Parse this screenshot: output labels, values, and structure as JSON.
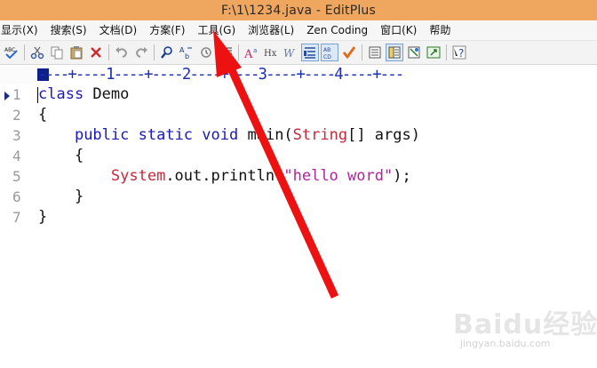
{
  "window": {
    "title": "F:\\1\\1234.java - EditPlus"
  },
  "menu": {
    "items": [
      "显示(X)",
      "搜索(S)",
      "文档(D)",
      "方案(F)",
      "工具(G)",
      "浏览器(L)",
      "Zen Coding",
      "窗口(K)",
      "帮助"
    ]
  },
  "toolbar": {
    "buttons": [
      "spell-check-icon",
      "cut-icon",
      "copy-icon",
      "paste-icon",
      "delete-icon",
      "undo-icon",
      "redo-icon",
      "find-icon",
      "replace-icon",
      "goto-icon",
      "indent-icon",
      "font-size-icon",
      "hex-icon",
      "word-wrap-icon",
      "line-number-icon",
      "column-select-icon",
      "check-icon",
      "view1-icon",
      "view2-icon",
      "view3-icon",
      "browser-icon",
      "help-icon"
    ],
    "colors": {
      "accent_active": "#7aa0cf",
      "delete": "#d02a2a",
      "check": "#e06a18"
    }
  },
  "ruler": {
    "text": "----+----1----+----2----+----3----+----4----+---"
  },
  "editor": {
    "line_numbers": [
      "1",
      "2",
      "3",
      "4",
      "5",
      "6",
      "7"
    ],
    "lines": [
      {
        "indent": "",
        "parts": [
          {
            "t": "class",
            "c": "kw"
          },
          {
            "t": " Demo",
            "c": ""
          }
        ]
      },
      {
        "indent": "",
        "parts": [
          {
            "t": "{",
            "c": ""
          }
        ]
      },
      {
        "indent": "    ",
        "parts": [
          {
            "t": "public",
            "c": "kw"
          },
          {
            "t": " ",
            "c": ""
          },
          {
            "t": "static",
            "c": "kw"
          },
          {
            "t": " ",
            "c": ""
          },
          {
            "t": "void",
            "c": "kw"
          },
          {
            "t": " main(",
            "c": ""
          },
          {
            "t": "String",
            "c": "cls"
          },
          {
            "t": "[] args)",
            "c": ""
          }
        ]
      },
      {
        "indent": "    ",
        "parts": [
          {
            "t": "{",
            "c": ""
          }
        ]
      },
      {
        "indent": "        ",
        "parts": [
          {
            "t": "System",
            "c": "cls"
          },
          {
            "t": ".out.println(",
            "c": ""
          },
          {
            "t": "\"hello word\"",
            "c": "str"
          },
          {
            "t": ");",
            "c": ""
          }
        ]
      },
      {
        "indent": "    ",
        "parts": [
          {
            "t": "}",
            "c": ""
          }
        ]
      },
      {
        "indent": "",
        "parts": [
          {
            "t": "}",
            "c": ""
          }
        ]
      }
    ],
    "colors": {
      "keyword": "#1a1ab8",
      "class": "#c8283a",
      "string": "#b0239e"
    }
  },
  "annotation": {
    "arrow_color": "#ee1111"
  },
  "watermark": {
    "brand": "Baidu经验",
    "url": "jingyan.baidu.com"
  }
}
